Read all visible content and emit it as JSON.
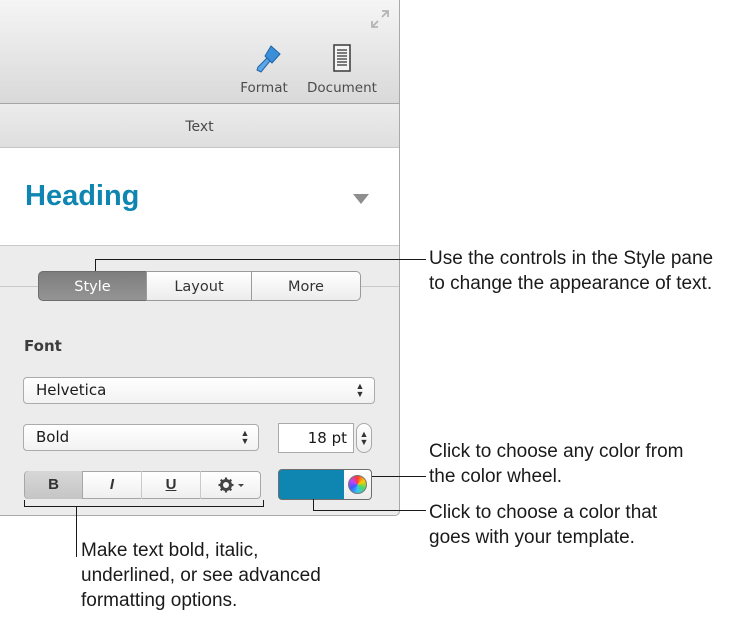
{
  "toolbar": {
    "format_label": "Format",
    "document_label": "Document"
  },
  "section_title": "Text",
  "paragraph_style": {
    "name": "Heading",
    "color": "#0f86b2"
  },
  "tabs": [
    {
      "label": "Style",
      "selected": true
    },
    {
      "label": "Layout",
      "selected": false
    },
    {
      "label": "More",
      "selected": false
    }
  ],
  "font": {
    "heading": "Font",
    "family": "Helvetica",
    "typeface": "Bold",
    "size": "18 pt"
  },
  "format_buttons": {
    "bold": "B",
    "italic": "I",
    "underline": "U"
  },
  "text_color": "#0f86b2",
  "callouts": {
    "style_pane": [
      "Use the controls in the Style pane",
      "to change the appearance of text."
    ],
    "color_wheel": [
      "Click to choose any color from",
      "the color wheel."
    ],
    "template_color": [
      "Click to choose a color that",
      "goes with your template."
    ],
    "format_options": [
      "Make text bold, italic,",
      "underlined, or see advanced",
      "formatting options."
    ]
  }
}
